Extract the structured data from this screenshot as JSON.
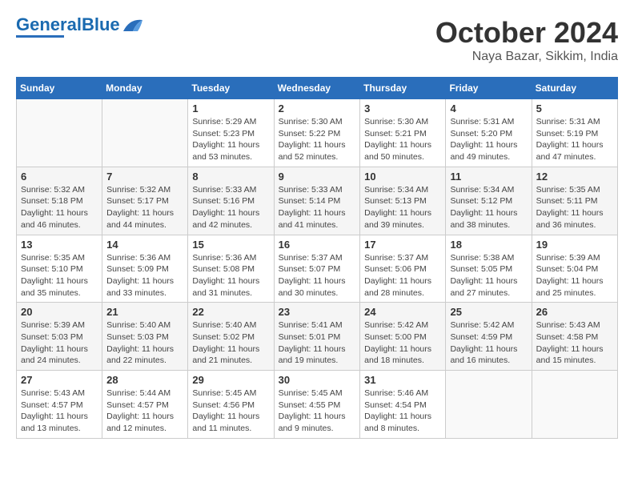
{
  "header": {
    "logo_general": "General",
    "logo_blue": "Blue",
    "month": "October 2024",
    "location": "Naya Bazar, Sikkim, India"
  },
  "columns": [
    "Sunday",
    "Monday",
    "Tuesday",
    "Wednesday",
    "Thursday",
    "Friday",
    "Saturday"
  ],
  "weeks": [
    [
      {
        "day": "",
        "info": ""
      },
      {
        "day": "",
        "info": ""
      },
      {
        "day": "1",
        "info": "Sunrise: 5:29 AM\nSunset: 5:23 PM\nDaylight: 11 hours and 53 minutes."
      },
      {
        "day": "2",
        "info": "Sunrise: 5:30 AM\nSunset: 5:22 PM\nDaylight: 11 hours and 52 minutes."
      },
      {
        "day": "3",
        "info": "Sunrise: 5:30 AM\nSunset: 5:21 PM\nDaylight: 11 hours and 50 minutes."
      },
      {
        "day": "4",
        "info": "Sunrise: 5:31 AM\nSunset: 5:20 PM\nDaylight: 11 hours and 49 minutes."
      },
      {
        "day": "5",
        "info": "Sunrise: 5:31 AM\nSunset: 5:19 PM\nDaylight: 11 hours and 47 minutes."
      }
    ],
    [
      {
        "day": "6",
        "info": "Sunrise: 5:32 AM\nSunset: 5:18 PM\nDaylight: 11 hours and 46 minutes."
      },
      {
        "day": "7",
        "info": "Sunrise: 5:32 AM\nSunset: 5:17 PM\nDaylight: 11 hours and 44 minutes."
      },
      {
        "day": "8",
        "info": "Sunrise: 5:33 AM\nSunset: 5:16 PM\nDaylight: 11 hours and 42 minutes."
      },
      {
        "day": "9",
        "info": "Sunrise: 5:33 AM\nSunset: 5:14 PM\nDaylight: 11 hours and 41 minutes."
      },
      {
        "day": "10",
        "info": "Sunrise: 5:34 AM\nSunset: 5:13 PM\nDaylight: 11 hours and 39 minutes."
      },
      {
        "day": "11",
        "info": "Sunrise: 5:34 AM\nSunset: 5:12 PM\nDaylight: 11 hours and 38 minutes."
      },
      {
        "day": "12",
        "info": "Sunrise: 5:35 AM\nSunset: 5:11 PM\nDaylight: 11 hours and 36 minutes."
      }
    ],
    [
      {
        "day": "13",
        "info": "Sunrise: 5:35 AM\nSunset: 5:10 PM\nDaylight: 11 hours and 35 minutes."
      },
      {
        "day": "14",
        "info": "Sunrise: 5:36 AM\nSunset: 5:09 PM\nDaylight: 11 hours and 33 minutes."
      },
      {
        "day": "15",
        "info": "Sunrise: 5:36 AM\nSunset: 5:08 PM\nDaylight: 11 hours and 31 minutes."
      },
      {
        "day": "16",
        "info": "Sunrise: 5:37 AM\nSunset: 5:07 PM\nDaylight: 11 hours and 30 minutes."
      },
      {
        "day": "17",
        "info": "Sunrise: 5:37 AM\nSunset: 5:06 PM\nDaylight: 11 hours and 28 minutes."
      },
      {
        "day": "18",
        "info": "Sunrise: 5:38 AM\nSunset: 5:05 PM\nDaylight: 11 hours and 27 minutes."
      },
      {
        "day": "19",
        "info": "Sunrise: 5:39 AM\nSunset: 5:04 PM\nDaylight: 11 hours and 25 minutes."
      }
    ],
    [
      {
        "day": "20",
        "info": "Sunrise: 5:39 AM\nSunset: 5:03 PM\nDaylight: 11 hours and 24 minutes."
      },
      {
        "day": "21",
        "info": "Sunrise: 5:40 AM\nSunset: 5:03 PM\nDaylight: 11 hours and 22 minutes."
      },
      {
        "day": "22",
        "info": "Sunrise: 5:40 AM\nSunset: 5:02 PM\nDaylight: 11 hours and 21 minutes."
      },
      {
        "day": "23",
        "info": "Sunrise: 5:41 AM\nSunset: 5:01 PM\nDaylight: 11 hours and 19 minutes."
      },
      {
        "day": "24",
        "info": "Sunrise: 5:42 AM\nSunset: 5:00 PM\nDaylight: 11 hours and 18 minutes."
      },
      {
        "day": "25",
        "info": "Sunrise: 5:42 AM\nSunset: 4:59 PM\nDaylight: 11 hours and 16 minutes."
      },
      {
        "day": "26",
        "info": "Sunrise: 5:43 AM\nSunset: 4:58 PM\nDaylight: 11 hours and 15 minutes."
      }
    ],
    [
      {
        "day": "27",
        "info": "Sunrise: 5:43 AM\nSunset: 4:57 PM\nDaylight: 11 hours and 13 minutes."
      },
      {
        "day": "28",
        "info": "Sunrise: 5:44 AM\nSunset: 4:57 PM\nDaylight: 11 hours and 12 minutes."
      },
      {
        "day": "29",
        "info": "Sunrise: 5:45 AM\nSunset: 4:56 PM\nDaylight: 11 hours and 11 minutes."
      },
      {
        "day": "30",
        "info": "Sunrise: 5:45 AM\nSunset: 4:55 PM\nDaylight: 11 hours and 9 minutes."
      },
      {
        "day": "31",
        "info": "Sunrise: 5:46 AM\nSunset: 4:54 PM\nDaylight: 11 hours and 8 minutes."
      },
      {
        "day": "",
        "info": ""
      },
      {
        "day": "",
        "info": ""
      }
    ]
  ]
}
